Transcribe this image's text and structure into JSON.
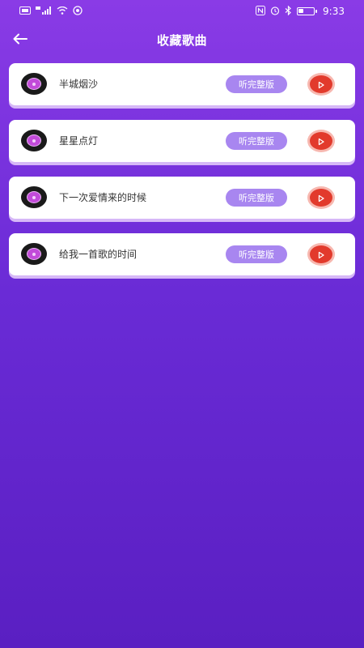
{
  "status_bar": {
    "left_icons": [
      "hd-icon",
      "5g-signal-icon",
      "wifi-icon",
      "nfc-status-icon"
    ],
    "right_icons": [
      "nfc-icon",
      "alarm-icon",
      "bluetooth-icon",
      "battery-icon"
    ],
    "time": "9:33",
    "battery_level": 0.35
  },
  "header": {
    "title": "收藏歌曲"
  },
  "songs": [
    {
      "title": "半城烟沙",
      "full_label": "听完整版"
    },
    {
      "title": "星星点灯",
      "full_label": "听完整版"
    },
    {
      "title": "下一次爱情来的时候",
      "full_label": "听完整版"
    },
    {
      "title": "给我一首歌的时间",
      "full_label": "听完整版"
    }
  ],
  "colors": {
    "background_top": "#8a3be6",
    "background_bottom": "#5a1fc2",
    "full_button": "#a886f0",
    "play_button": "#e23a2c"
  }
}
